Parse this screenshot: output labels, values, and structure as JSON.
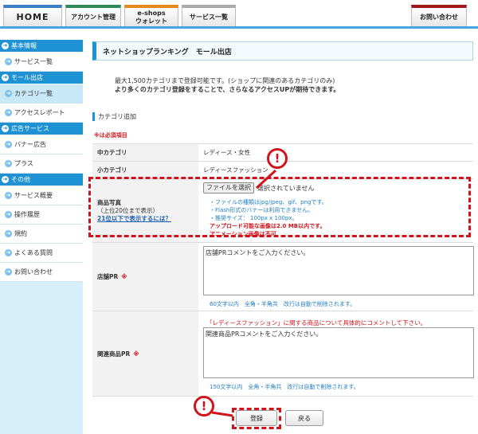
{
  "nav": {
    "home": "HOME",
    "account": "アカウント管理",
    "eshops_line1": "e-shops",
    "eshops_line2": "ウォレット",
    "service": "サービス一覧",
    "contact": "お問い合わせ"
  },
  "sidebar": {
    "sections": [
      {
        "head": "基本情報",
        "items": [
          "サービス一覧"
        ]
      },
      {
        "head": "モール出店",
        "items": [
          "カテゴリ一覧",
          "アクセスレポート"
        ]
      },
      {
        "head": "広告サービス",
        "items": [
          "バナー広告",
          "プラス"
        ]
      },
      {
        "head": "その他",
        "items": [
          "サービス概要",
          "操作履歴",
          "規約",
          "よくある質問",
          "お問い合わせ"
        ]
      }
    ]
  },
  "page": {
    "title": "ネットショップランキング　モール出店",
    "notice_line1": "最大1,500カテゴリまで登録可能です。(ショップに関連のあるカテゴリのみ)",
    "notice_line2": "より多くのカテゴリ登録をすることで、さらなるアクセスUPが期待できます。",
    "section_title": "カテゴリ追加",
    "required_note": "※は必須項目"
  },
  "form": {
    "middle_category_label": "中カテゴリ",
    "middle_category_value": "レディース・女性",
    "small_category_label": "小カテゴリ",
    "small_category_value": "レディースファッション",
    "photo_label": "商品写真",
    "photo_sub": "（上位20位まで表示）",
    "photo_link": "21位以下で表示するには？",
    "file_button": "ファイルを選択",
    "file_none": "選択されていません",
    "hints": [
      "・ファイルの種類はjpg/jpeg、gif、pngです。",
      "・Flash形式のバナーは利用できません。",
      "・推奨サイズ： 100px x 100px。"
    ],
    "warn1": "アップロード可能な画像は2.0 MB以内です。",
    "warn2": "アニメーション画像は不可",
    "shop_pr_label": "店舗PR",
    "shop_pr_placeholder": "店舗PRコメントをご入力ください。",
    "shop_pr_count": "60文字以内　全角・半角共　改行は自動で削除されます。",
    "product_pr_label": "関連商品PR",
    "product_pr_notice": "「レディースファッション」に関する商品について具体的にコメントして下さい。",
    "product_pr_placeholder": "関連商品PRコメントをご入力ください。",
    "product_pr_count": "150文字以内　全角・半角共　改行は自動で削除されます。",
    "required_mark": "※",
    "submit": "登録",
    "back": "戻る"
  },
  "annotation": {
    "mark": "!"
  },
  "colors": {
    "accent": "#1f92d3",
    "highlight": "#d0141b"
  }
}
